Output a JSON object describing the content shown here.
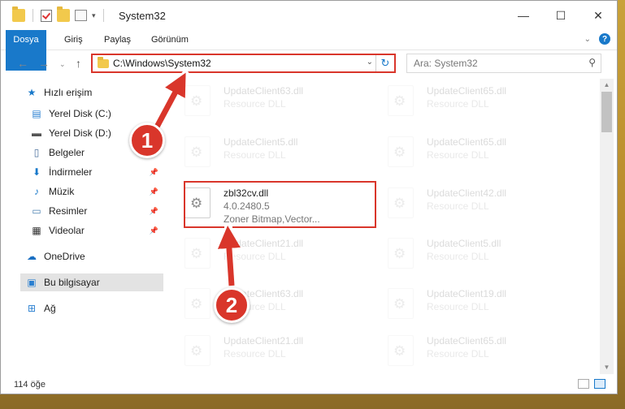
{
  "window": {
    "title": "System32"
  },
  "ribbon": {
    "tabs": [
      "Dosya",
      "Giriş",
      "Paylaş",
      "Görünüm"
    ]
  },
  "address": {
    "path": "C:\\Windows\\System32",
    "search_placeholder": "Ara: System32"
  },
  "navpane": {
    "items": [
      {
        "label": "Hızlı erişim",
        "icon": "star-icon",
        "pinned": false
      },
      {
        "label": "Yerel Disk (C:)",
        "icon": "drive-icon",
        "pinned": false
      },
      {
        "label": "Yerel Disk (D:)",
        "icon": "drive-icon",
        "pinned": false
      },
      {
        "label": "Belgeler",
        "icon": "documents-icon",
        "pinned": true
      },
      {
        "label": "İndirmeler",
        "icon": "download-icon",
        "pinned": true
      },
      {
        "label": "Müzik",
        "icon": "music-icon",
        "pinned": true
      },
      {
        "label": "Resimler",
        "icon": "pictures-icon",
        "pinned": true
      },
      {
        "label": "Videolar",
        "icon": "videos-icon",
        "pinned": true
      },
      {
        "label": "OneDrive",
        "icon": "cloud-icon",
        "pinned": false
      },
      {
        "label": "Bu bilgisayar",
        "icon": "computer-icon",
        "pinned": false
      },
      {
        "label": "Ağ",
        "icon": "network-icon",
        "pinned": false
      }
    ]
  },
  "files": {
    "left": [
      {
        "name": "UpdateClient63.dll",
        "desc": "Resource DLL"
      },
      {
        "name": "UpdateClient5.dll",
        "desc": "Resource DLL"
      },
      {
        "name": "zbl32cv.dll",
        "version": "4.0.2480.5",
        "desc": "Zoner Bitmap,Vector..."
      },
      {
        "name": "UpdateClient21.dll",
        "desc": "Resource DLL"
      },
      {
        "name": "UpdateClient63.dll",
        "desc": "Resource DLL"
      },
      {
        "name": "UpdateClient21.dll",
        "desc": "Resource DLL"
      }
    ],
    "right": [
      {
        "name": "UpdateClient65.dll",
        "desc": "Resource DLL"
      },
      {
        "name": "UpdateClient65.dll",
        "desc": "Resource DLL"
      },
      {
        "name": "UpdateClient42.dll",
        "desc": "Resource DLL"
      },
      {
        "name": "UpdateClient5.dll",
        "desc": "Resource DLL"
      },
      {
        "name": "UpdateClient19.dll",
        "desc": "Resource DLL"
      },
      {
        "name": "UpdateClient65.dll",
        "desc": "Resource DLL"
      }
    ]
  },
  "status": {
    "count": "114 öğe"
  },
  "annotations": {
    "badge1": "1",
    "badge2": "2",
    "color": "#d9362b"
  }
}
